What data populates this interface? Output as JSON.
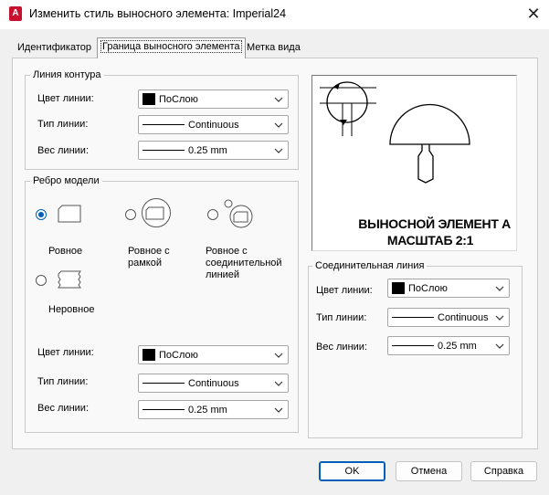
{
  "window": {
    "app_icon_letter": "A",
    "title": "Изменить стиль выносного элемента: Imperial24",
    "close_glyph": "✕"
  },
  "tabs": [
    {
      "label": "Идентификатор",
      "active": false
    },
    {
      "label": "Граница выносного элемента",
      "active": true
    },
    {
      "label": "Метка вида",
      "active": false
    }
  ],
  "contour_group": {
    "title": "Линия контура",
    "color": {
      "label": "Цвет линии:",
      "value": "ПоСлою"
    },
    "linetype": {
      "label": "Тип линии:",
      "value": "Continuous"
    },
    "lineweight": {
      "label": "Вес линии:",
      "value": "0.25 mm"
    }
  },
  "model_edge_group": {
    "title": "Ребро модели",
    "options": [
      {
        "label": "Ровное",
        "selected": true
      },
      {
        "label": "Ровное с рамкой",
        "selected": false
      },
      {
        "label": "Ровное с соединительной линией",
        "selected": false
      },
      {
        "label": "Неровное",
        "selected": false
      }
    ],
    "color": {
      "label": "Цвет линии:",
      "value": "ПоСлою"
    },
    "linetype": {
      "label": "Тип линии:",
      "value": "Continuous"
    },
    "lineweight": {
      "label": "Вес линии:",
      "value": "0.25 mm"
    }
  },
  "preview": {
    "line1": "ВЫНОСНОЙ ЭЛЕМЕНТ А",
    "line2": "МАСШТАБ 2:1"
  },
  "connection_group": {
    "title": "Соединительная линия",
    "color": {
      "label": "Цвет линии:",
      "value": "ПоСлою"
    },
    "linetype": {
      "label": "Тип линии:",
      "value": "Continuous"
    },
    "lineweight": {
      "label": "Вес линии:",
      "value": "0.25 mm"
    }
  },
  "buttons": {
    "ok": "OK",
    "cancel": "Отмена",
    "help": "Справка"
  },
  "colors": {
    "accent": "#005fb8",
    "app_icon": "#c8102e",
    "swatch": "#000000"
  }
}
